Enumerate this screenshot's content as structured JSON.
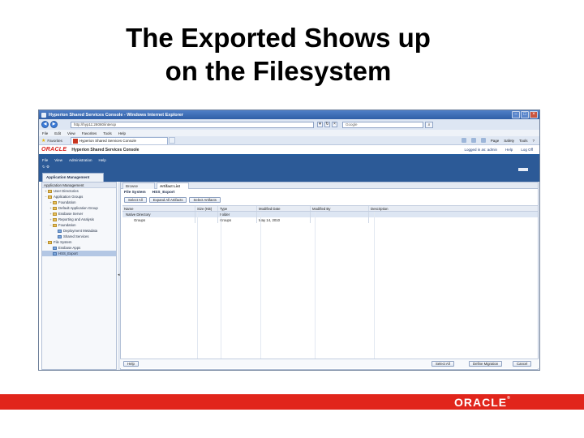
{
  "slide": {
    "title_line1": "The Exported Shows up",
    "title_line2": "on the Filesystem"
  },
  "browser": {
    "window_title": "Hyperion Shared Services Console - Windows Internet Explorer",
    "url": "http://hyp11:28080/interop",
    "search_placeholder": "Google",
    "menu": [
      "File",
      "Edit",
      "View",
      "Favorites",
      "Tools",
      "Help"
    ],
    "favorites_label": "Favorites",
    "tab_title": "Hyperion Shared Services Console",
    "tools": [
      "Page",
      "Safety",
      "Tools"
    ]
  },
  "console": {
    "logo": "ORACLE",
    "product": "Hyperion Shared Services Console",
    "user_links": [
      "Logged in as: admin",
      "Help",
      "Log Off"
    ],
    "menu": [
      "File",
      "View",
      "Administration",
      "Help"
    ],
    "app_tab": "Application Management"
  },
  "left_panel": {
    "header": "Application Management",
    "tree": [
      {
        "indent": 0,
        "toggle": "+",
        "icon": "folder",
        "label": "User Directories"
      },
      {
        "indent": 0,
        "toggle": "−",
        "icon": "folder",
        "label": "Application Groups"
      },
      {
        "indent": 1,
        "toggle": "+",
        "icon": "folder",
        "label": "Foundation"
      },
      {
        "indent": 1,
        "toggle": "+",
        "icon": "folder",
        "label": "Default Application Group"
      },
      {
        "indent": 1,
        "toggle": "+",
        "icon": "folder",
        "label": "Essbase Server"
      },
      {
        "indent": 1,
        "toggle": "+",
        "icon": "folder",
        "label": "Reporting and Analysis"
      },
      {
        "indent": 1,
        "toggle": "−",
        "icon": "folder",
        "label": "Foundation"
      },
      {
        "indent": 2,
        "toggle": "",
        "icon": "app",
        "label": "Deployment Metadata"
      },
      {
        "indent": 2,
        "toggle": "",
        "icon": "app",
        "label": "Shared Services"
      },
      {
        "indent": 0,
        "toggle": "−",
        "icon": "folder",
        "label": "File System"
      },
      {
        "indent": 1,
        "toggle": "",
        "icon": "app",
        "label": "Essbase Apps"
      },
      {
        "indent": 1,
        "toggle": "",
        "icon": "app",
        "label": "HSS_Export",
        "selected": true
      }
    ]
  },
  "right_panel": {
    "tabs": [
      "Browse",
      "Artifact List"
    ],
    "crumbs": [
      "File System",
      "HSS_Export"
    ],
    "buttons": [
      "Select All",
      "Expand All Artifacts",
      "Select Artifacts"
    ],
    "columns": [
      "Name",
      "Size (KB)",
      "Type",
      "Modified Date",
      "Modified By",
      "Description"
    ],
    "rows": [
      {
        "name": "Native Directory",
        "size": "",
        "type": "Folder",
        "modified_date": "",
        "modified_by": "",
        "description": "",
        "selected": true
      },
      {
        "name": "Groups",
        "size": "",
        "type": "Groups",
        "modified_date": "May 14, 2010",
        "modified_by": "",
        "description": ""
      }
    ],
    "bottom_buttons": {
      "left": "Help",
      "right": [
        "Select All",
        "Define Migration",
        "Cancel"
      ]
    }
  },
  "footer": {
    "logo": "ORACLE",
    "band_color": "#e1251b"
  }
}
